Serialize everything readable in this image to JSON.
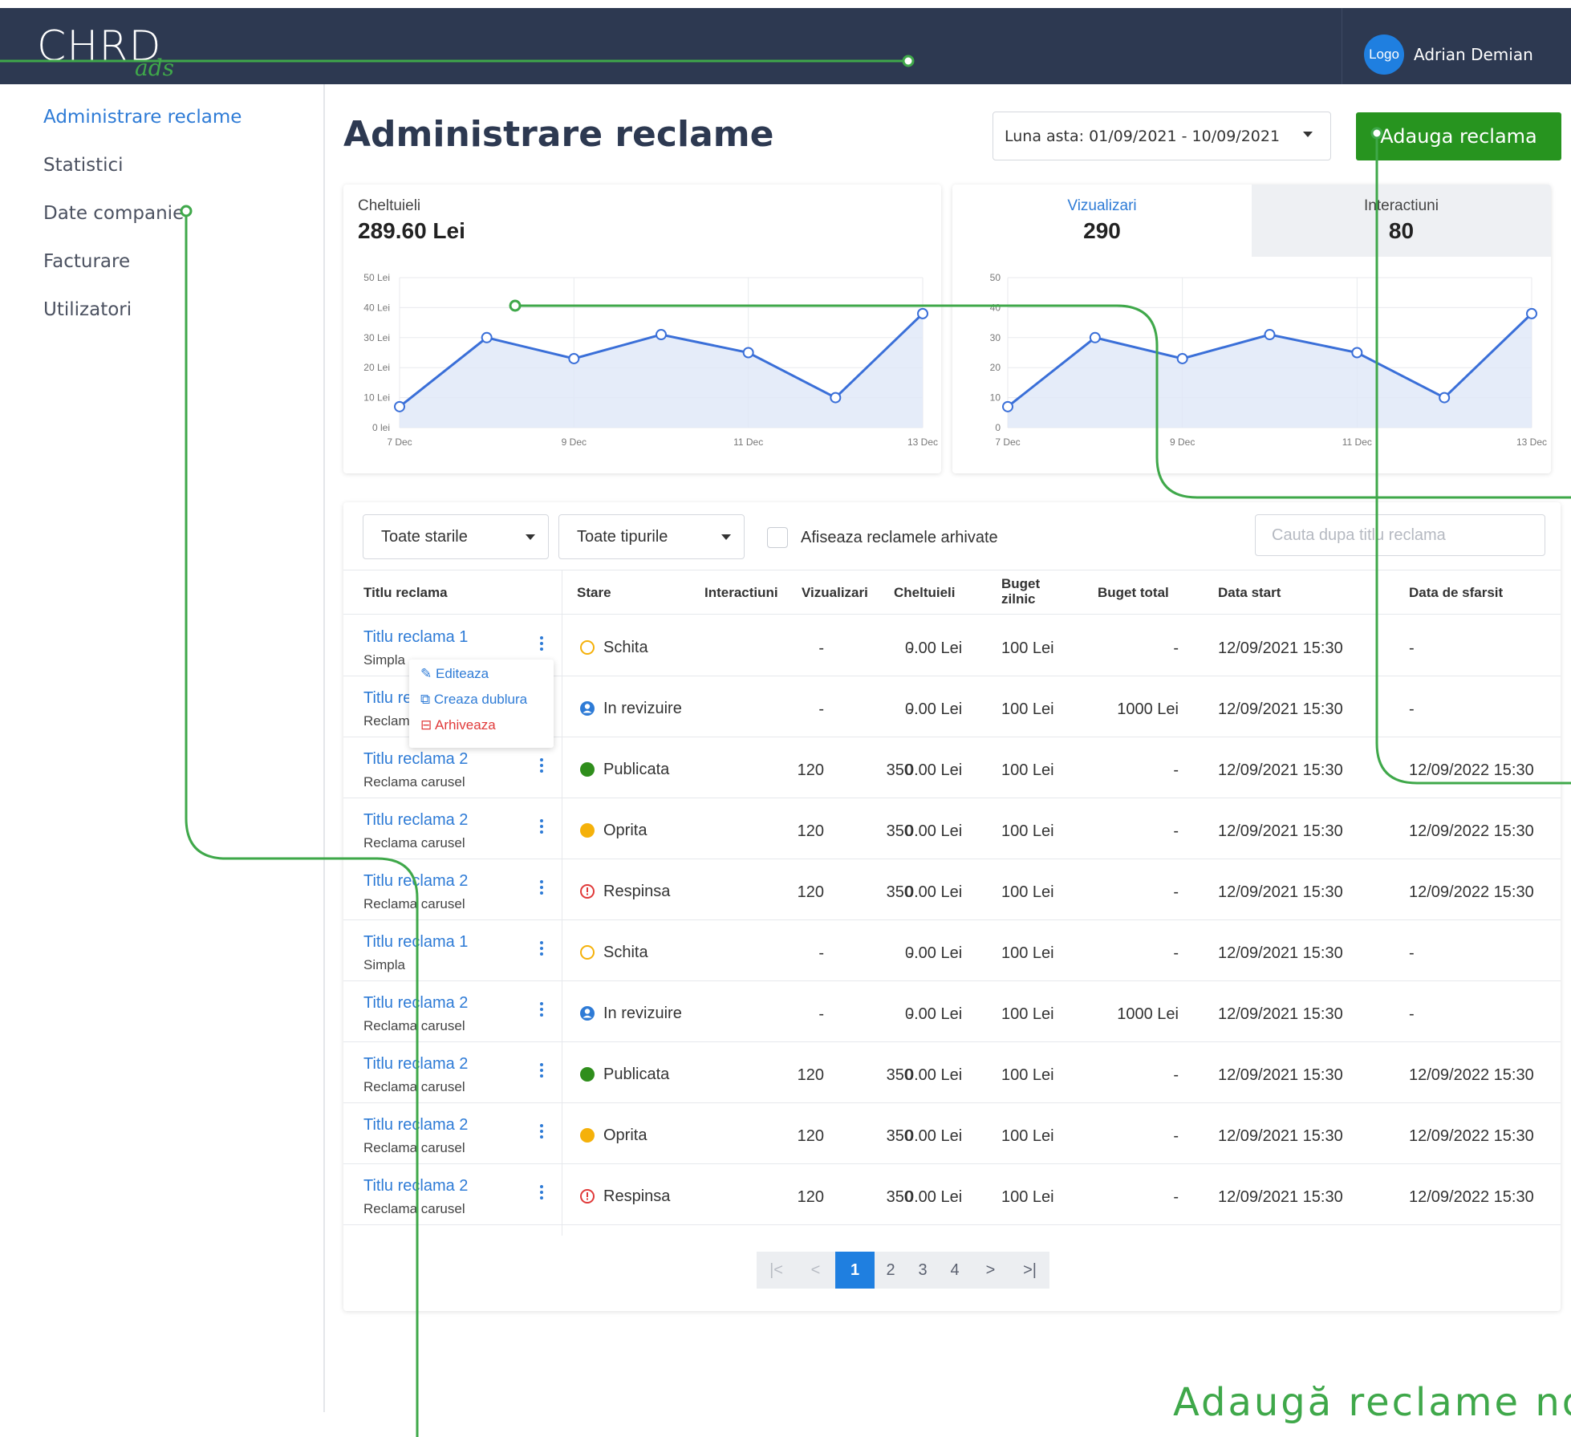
{
  "header": {
    "brand": "CHRD",
    "brand_sub": "ads",
    "avatar_text": "Logo",
    "username": "Adrian Demian"
  },
  "sidebar": {
    "items": [
      {
        "label": "Administrare reclame",
        "active": true
      },
      {
        "label": "Statistici",
        "active": false
      },
      {
        "label": "Date companie",
        "active": false
      },
      {
        "label": "Facturare",
        "active": false
      },
      {
        "label": "Utilizatori",
        "active": false
      }
    ]
  },
  "main": {
    "title": "Administrare reclame",
    "date_range": "Luna asta: 01/09/2021 - 10/09/2021",
    "add_button": "Adauga reclama"
  },
  "stats": {
    "spend_label": "Cheltuieli",
    "spend_value": "289.60 Lei",
    "views_label": "Vizualizari",
    "views_value": "290",
    "interactions_label": "Interactiuni",
    "interactions_value": "80"
  },
  "chart_data": [
    {
      "type": "area",
      "title": "",
      "x_ticks": [
        "7 Dec",
        "9 Dec",
        "11 Dec",
        "13 Dec"
      ],
      "y_ticks": [
        "0 lei",
        "10 Lei",
        "20 Lei",
        "30 Lei",
        "40 Lei",
        "50 Lei"
      ],
      "ylim": [
        0,
        50
      ],
      "values": [
        7,
        30,
        23,
        31,
        25,
        10,
        38
      ],
      "grid": true,
      "color": "#3a6fd8"
    },
    {
      "type": "area",
      "title": "",
      "x_ticks": [
        "7 Dec",
        "9 Dec",
        "11 Dec",
        "13 Dec"
      ],
      "y_ticks": [
        "0",
        "10",
        "20",
        "30",
        "40",
        "50"
      ],
      "ylim": [
        0,
        50
      ],
      "values": [
        7,
        30,
        23,
        31,
        25,
        10,
        38
      ],
      "grid": true,
      "color": "#3a6fd8"
    }
  ],
  "filters": {
    "status": "Toate starile",
    "type": "Toate tipurile",
    "archived_label": "Afiseaza reclamele arhivate",
    "search_placeholder": "Cauta dupa titlu reclama"
  },
  "table": {
    "headers": {
      "title": "Titlu reclama",
      "status": "Stare",
      "interactions": "Interactiuni",
      "views": "Vizualizari",
      "spend": "Cheltuieli",
      "daily_budget_1": "Buget",
      "daily_budget_2": "zilnic",
      "total_budget": "Buget total",
      "start": "Data start",
      "end": "Data de sfarsit"
    },
    "rows": [
      {
        "title": "Titlu reclama 1",
        "sub": "Simpla",
        "status": "Schita",
        "status_kind": "draft",
        "interactions": "-",
        "views": "-",
        "spend": "0.00 Lei",
        "daily": "100 Lei",
        "total": "-",
        "start": "12/09/2021 15:30",
        "end": "-"
      },
      {
        "title": "Titlu reclama 2",
        "sub": "Reclama carusel",
        "status": "In revizuire",
        "status_kind": "review",
        "interactions": "-",
        "views": "-",
        "spend": "0.00 Lei",
        "daily": "100 Lei",
        "total": "1000 Lei",
        "start": "12/09/2021 15:30",
        "end": "-"
      },
      {
        "title": "Titlu reclama 2",
        "sub": "Reclama carusel",
        "status": "Publicata",
        "status_kind": "published",
        "interactions": "120",
        "views": "350",
        "spend": "0.00 Lei",
        "daily": "100 Lei",
        "total": "-",
        "start": "12/09/2021 15:30",
        "end": "12/09/2022 15:30"
      },
      {
        "title": "Titlu reclama 2",
        "sub": "Reclama carusel",
        "status": "Oprita",
        "status_kind": "stopped",
        "interactions": "120",
        "views": "350",
        "spend": "0.00 Lei",
        "daily": "100 Lei",
        "total": "-",
        "start": "12/09/2021 15:30",
        "end": "12/09/2022 15:30"
      },
      {
        "title": "Titlu reclama 2",
        "sub": "Reclama carusel",
        "status": "Respinsa",
        "status_kind": "rejected",
        "interactions": "120",
        "views": "350",
        "spend": "0.00 Lei",
        "daily": "100 Lei",
        "total": "-",
        "start": "12/09/2021 15:30",
        "end": "12/09/2022 15:30"
      },
      {
        "title": "Titlu reclama 1",
        "sub": "Simpla",
        "status": "Schita",
        "status_kind": "draft",
        "interactions": "-",
        "views": "-",
        "spend": "0.00 Lei",
        "daily": "100 Lei",
        "total": "-",
        "start": "12/09/2021 15:30",
        "end": "-"
      },
      {
        "title": "Titlu reclama 2",
        "sub": "Reclama carusel",
        "status": "In revizuire",
        "status_kind": "review",
        "interactions": "-",
        "views": "-",
        "spend": "0.00 Lei",
        "daily": "100 Lei",
        "total": "1000 Lei",
        "start": "12/09/2021 15:30",
        "end": "-"
      },
      {
        "title": "Titlu reclama 2",
        "sub": "Reclama carusel",
        "status": "Publicata",
        "status_kind": "published",
        "interactions": "120",
        "views": "350",
        "spend": "0.00 Lei",
        "daily": "100 Lei",
        "total": "-",
        "start": "12/09/2021 15:30",
        "end": "12/09/2022 15:30"
      },
      {
        "title": "Titlu reclama 2",
        "sub": "Reclama carusel",
        "status": "Oprita",
        "status_kind": "stopped",
        "interactions": "120",
        "views": "350",
        "spend": "0.00 Lei",
        "daily": "100 Lei",
        "total": "-",
        "start": "12/09/2021 15:30",
        "end": "12/09/2022 15:30"
      },
      {
        "title": "Titlu reclama 2",
        "sub": "Reclama carusel",
        "status": "Respinsa",
        "status_kind": "rejected",
        "interactions": "120",
        "views": "350",
        "spend": "0.00 Lei",
        "daily": "100 Lei",
        "total": "-",
        "start": "12/09/2021 15:30",
        "end": "12/09/2022 15:30"
      }
    ]
  },
  "row_menu": {
    "edit": "Editeaza",
    "duplicate": "Creaza dublura",
    "archive": "Arhiveaza"
  },
  "pagination": {
    "first": "|<",
    "prev": "<",
    "pages": [
      "1",
      "2",
      "3",
      "4"
    ],
    "current": "1",
    "next": ">",
    "last": ">|"
  },
  "colors": {
    "header_bg": "#2d3951",
    "accent_blue": "#2e7bd6",
    "add_green": "#27941f",
    "annotation_green": "#3fa84a",
    "status_published": "#2f8e1c",
    "status_stopped": "#f5b10a",
    "status_rejected": "#e03a3a",
    "status_draft": "#f5b10a",
    "status_review": "#2e7bd6"
  },
  "annotation": {
    "caption": "Adaugă reclame no"
  }
}
